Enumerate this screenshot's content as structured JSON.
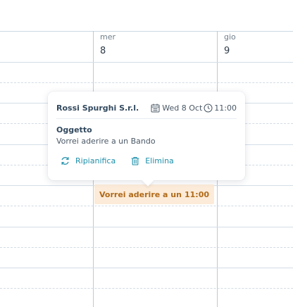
{
  "calendar": {
    "days": [
      {
        "name": "mer",
        "number": "8"
      },
      {
        "name": "gio",
        "number": "9"
      }
    ]
  },
  "event": {
    "title": "Vorrei aderire a un ...",
    "time": "11:00",
    "color": "#fcebd8",
    "text_color": "#b06a1a"
  },
  "popover": {
    "company": "Rossi Spurghi S.r.l.",
    "date": "Wed 8 Oct",
    "time": "11:00",
    "subject_label": "Oggetto",
    "subject_text": "Vorrei aderire a un Bando",
    "reschedule_label": "Ripianifica",
    "delete_label": "Elimina",
    "accent": "#1c8fa9",
    "icons": [
      "calendar-icon",
      "clock-icon",
      "refresh-icon",
      "trash-icon"
    ]
  }
}
